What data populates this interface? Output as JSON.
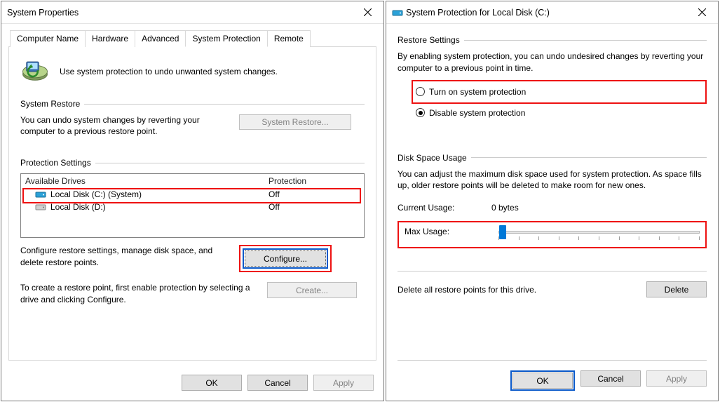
{
  "left": {
    "title": "System Properties",
    "tabs": [
      "Computer Name",
      "Hardware",
      "Advanced",
      "System Protection",
      "Remote"
    ],
    "active_tab_index": 3,
    "intro": "Use system protection to undo unwanted system changes.",
    "restore": {
      "heading": "System Restore",
      "text": "You can undo system changes by reverting your computer to a previous restore point.",
      "button": "System Restore..."
    },
    "settings": {
      "heading": "Protection Settings",
      "col_drive": "Available Drives",
      "col_prot": "Protection",
      "drives": [
        {
          "name": "Local Disk (C:) (System)",
          "protection": "Off",
          "color": "#2aa1d8"
        },
        {
          "name": "Local Disk (D:)",
          "protection": "Off",
          "color": "#a0a0a0"
        }
      ],
      "configure_text": "Configure restore settings, manage disk space, and delete restore points.",
      "configure_button": "Configure...",
      "create_text": "To create a restore point, first enable protection by selecting a drive and clicking Configure.",
      "create_button": "Create..."
    },
    "footer": {
      "ok": "OK",
      "cancel": "Cancel",
      "apply": "Apply"
    }
  },
  "right": {
    "title": "System Protection for Local Disk (C:)",
    "restore": {
      "heading": "Restore Settings",
      "text": "By enabling system protection, you can undo undesired changes by reverting your computer to a previous point in time.",
      "opt_on": "Turn on system protection",
      "opt_off": "Disable system protection"
    },
    "disk": {
      "heading": "Disk Space Usage",
      "text": "You can adjust the maximum disk space used for system protection. As space fills up, older restore points will be deleted to make room for new ones.",
      "current_label": "Current Usage:",
      "current_value": "0 bytes",
      "max_label": "Max Usage:"
    },
    "delete": {
      "text": "Delete all restore points for this drive.",
      "button": "Delete"
    },
    "footer": {
      "ok": "OK",
      "cancel": "Cancel",
      "apply": "Apply"
    }
  }
}
